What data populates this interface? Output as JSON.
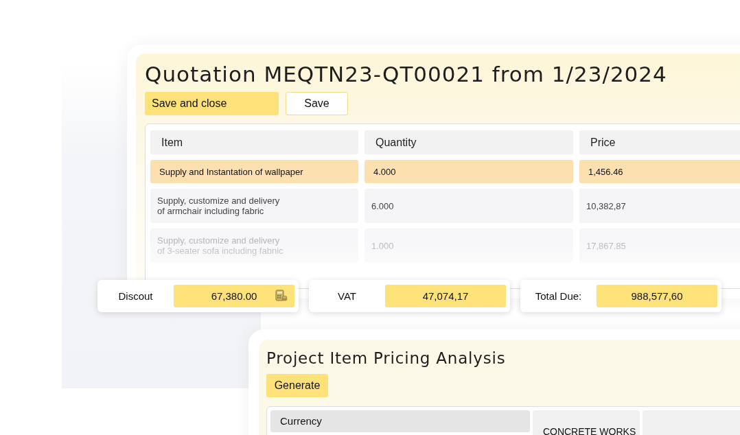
{
  "quotation": {
    "title": "Quotation MEQTN23-QT00021 from 1/23/2024",
    "buttons": [
      {
        "label": "Save and close",
        "kind": "primary"
      },
      {
        "label": "Save",
        "kind": "secondary"
      }
    ],
    "table": {
      "columns": [
        "Item",
        "Quantity",
        "Price"
      ],
      "rows": [
        {
          "cells": [
            "Supply and Instantation of wallpaper",
            "4.000",
            "1,456.46"
          ],
          "selected": true
        },
        {
          "cells": [
            "Supply, customize and delivery\nof armchair including fabric",
            "6.000",
            "10,382,87"
          ],
          "selected": false
        },
        {
          "cells": [
            "Supply, customize and delivery\nof 3-seater sofa including fabnic",
            "1.000",
            "17,867.85"
          ],
          "selected": false
        }
      ]
    }
  },
  "summary": [
    {
      "label": "Discout",
      "value": "67,380.00",
      "calculator": true
    },
    {
      "label": "VAT",
      "value": "47,074,17",
      "calculator": false
    },
    {
      "label": "Total Due:",
      "value": "988,577,60",
      "calculator": false
    }
  ],
  "analysis": {
    "title": "Project Item Pricing Analysis",
    "button": "Generate",
    "columns": [
      "Currency",
      "CONCRETE WORKS"
    ]
  }
}
